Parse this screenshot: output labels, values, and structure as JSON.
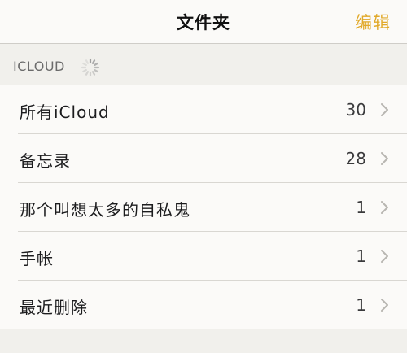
{
  "nav": {
    "title": "文件夹",
    "edit_label": "编辑"
  },
  "section": {
    "label": "ICLOUD",
    "loading": true
  },
  "folders": [
    {
      "name": "所有iCloud",
      "count": "30"
    },
    {
      "name": "备忘录",
      "count": "28"
    },
    {
      "name": "那个叫想太多的自私鬼",
      "count": "1"
    },
    {
      "name": "手帐",
      "count": "1"
    },
    {
      "name": "最近删除",
      "count": "1"
    }
  ],
  "colors": {
    "accent": "#e1a92a",
    "background": "#f5f4f1"
  }
}
